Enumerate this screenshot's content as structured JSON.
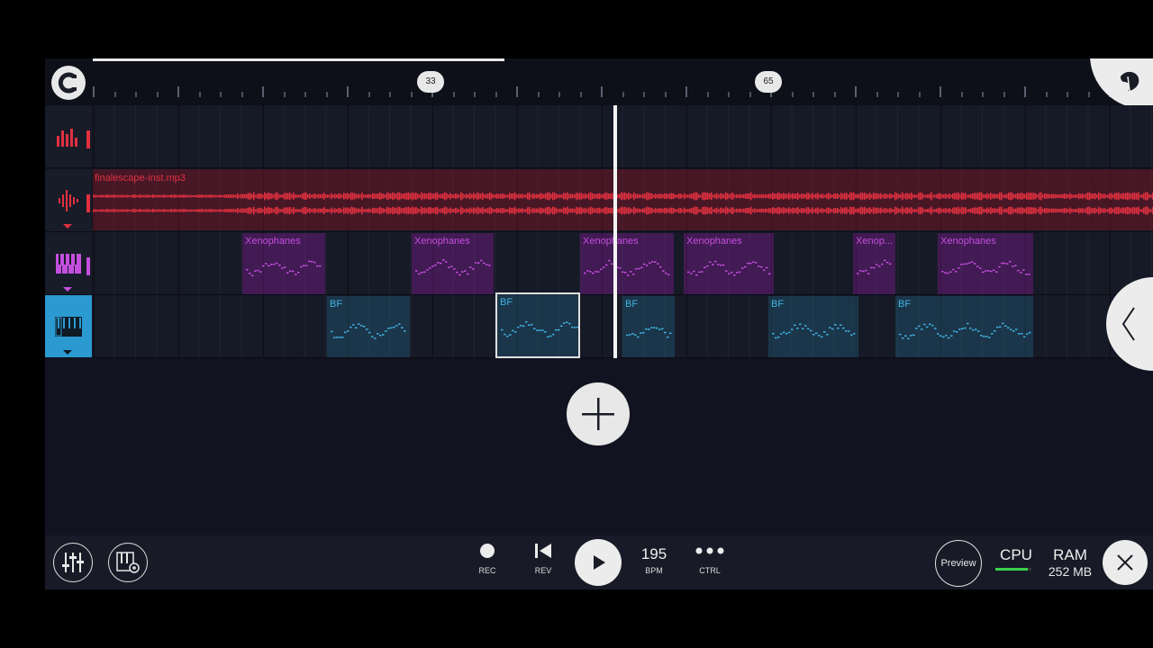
{
  "timeline": {
    "bar_markers": [
      "33",
      "65"
    ]
  },
  "tracks": [
    {
      "icon": "mixer-bars-icon"
    },
    {
      "icon": "audio-waveform-icon"
    },
    {
      "icon": "pink-keys-icon"
    },
    {
      "icon": "piano-keys-icon"
    }
  ],
  "audio_clip": {
    "name": "finalescape-inst.mp3"
  },
  "pattern_clips_xenophanes": [
    {
      "label": "Xenophanes"
    },
    {
      "label": "Xenophanes"
    },
    {
      "label": "Xenophanes"
    },
    {
      "label": "Xenophanes"
    },
    {
      "label": "Xenop..."
    },
    {
      "label": "Xenophanes"
    }
  ],
  "pattern_clips_bf": [
    {
      "label": "BF"
    },
    {
      "label": "BF"
    },
    {
      "label": "BF"
    },
    {
      "label": "BF"
    },
    {
      "label": "BF"
    }
  ],
  "toolbar": {
    "rec_label": "REC",
    "rev_label": "REV",
    "bpm_value": "195",
    "bpm_label": "BPM",
    "ctrl_label": "CTRL",
    "preview_label": "Preview",
    "cpu_label": "CPU",
    "cpu_load": 0.9,
    "ram_label": "RAM",
    "ram_value": "252 MB"
  },
  "colors": {
    "accent_selected_track": "#2a9ad1",
    "audio_wave": "#e0303f",
    "pattern_xenophanes": "#c44fde",
    "pattern_bf": "#3fb3e3",
    "cpu_meter": "#3ad14b"
  }
}
